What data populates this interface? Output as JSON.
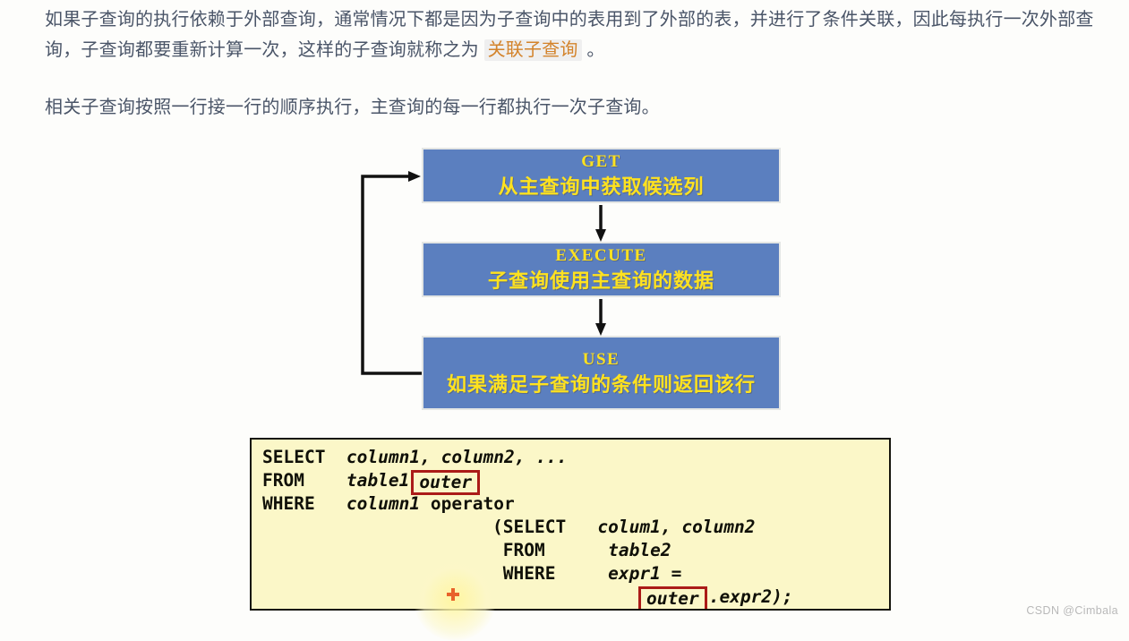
{
  "paragraphs": {
    "p1_before": "如果子查询的执行依赖于外部查询，通常情况下都是因为子查询中的表用到了外部的表，并进行了条件关联，因此每执行一次外部查询，子查询都要重新计算一次，这样的子查询就称之为 ",
    "p1_highlight": "关联子查询",
    "p1_after": " 。",
    "p2": "相关子查询按照一行接一行的顺序执行，主查询的每一行都执行一次子查询。"
  },
  "flowchart": {
    "box_color": "#5b7fbf",
    "text_color": "#ffe21f",
    "steps": [
      {
        "keyword": "GET",
        "description": "从主查询中获取候选列"
      },
      {
        "keyword": "EXECUTE",
        "description": "子查询使用主查询的数据"
      },
      {
        "keyword": "USE",
        "description": "如果满足子查询的条件则返回该行"
      }
    ]
  },
  "code": {
    "background": "#fbf7c8",
    "highlight_border": "#ab1b18",
    "lines": {
      "l1_kw": "SELECT",
      "l1_id": "  column1, column2, ...",
      "l2_kw": "FROM",
      "l2_id": "    table1",
      "l2_boxed": "outer",
      "l3_kw": "WHERE",
      "l3_id": "   column1",
      "l3_kw2": " operator",
      "l4_kw": "(SELECT",
      "l4_id": "   colum1, column2",
      "l5_kw": " FROM",
      "l5_id": "      table2",
      "l6_kw": " WHERE",
      "l6_id": "     expr1 =",
      "l7_boxed": "outer",
      "l7_rest": ".expr2);"
    }
  },
  "watermark": "CSDN @Cimbala"
}
